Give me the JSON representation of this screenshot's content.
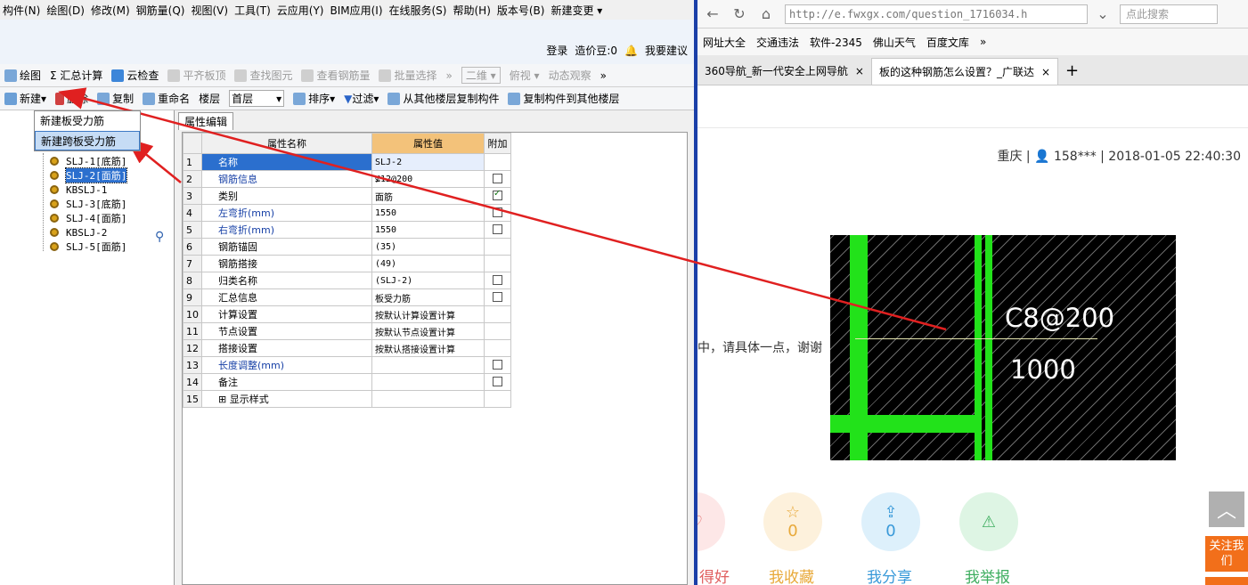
{
  "menu": [
    "构件(N)",
    "绘图(D)",
    "修改(M)",
    "钢筋量(Q)",
    "视图(V)",
    "工具(T)",
    "云应用(Y)",
    "BIM应用(I)",
    "在线服务(S)",
    "帮助(H)",
    "版本号(B)",
    "新建变更 ▾"
  ],
  "login": {
    "login": "登录",
    "beans": "造价豆:0",
    "suggest": "我要建议"
  },
  "toolbar1": [
    "绘图",
    "Σ 汇总计算",
    "云检查",
    "平齐板顶",
    "查找图元",
    "查看钢筋量",
    "批量选择",
    "二维",
    "俯视",
    "动态观察"
  ],
  "toolbar2": {
    "new": "新建",
    "delete": "删除",
    "copy": "复制",
    "rename": "重命名",
    "floor_label": "楼层",
    "floor_value": "首层",
    "sort": "排序",
    "filter": "过滤",
    "copy_from": "从其他楼层复制构件",
    "copy_to": "复制构件到其他楼层"
  },
  "dropdown": [
    "新建板受力筋",
    "新建跨板受力筋"
  ],
  "tree": [
    "SLJ-1[底筋]",
    "SLJ-2[面筋]",
    "KBSLJ-1",
    "SLJ-3[底筋]",
    "SLJ-4[面筋]",
    "KBSLJ-2",
    "SLJ-5[面筋]"
  ],
  "panel_tab": "属性编辑",
  "grid": {
    "headers": [
      "属性名称",
      "属性值",
      "附加"
    ],
    "rows": [
      {
        "n": "1",
        "name": "名称",
        "val": "SLJ-2",
        "cb": ""
      },
      {
        "n": "2",
        "name": "钢筋信息",
        "val": "⊈12@200",
        "cb": "off"
      },
      {
        "n": "3",
        "name": "类别",
        "val": "面筋",
        "cb": "on"
      },
      {
        "n": "4",
        "name": "左弯折(mm)",
        "val": "1550",
        "cb": "off"
      },
      {
        "n": "5",
        "name": "右弯折(mm)",
        "val": "1550",
        "cb": "off"
      },
      {
        "n": "6",
        "name": "钢筋锚固",
        "val": "(35)",
        "cb": ""
      },
      {
        "n": "7",
        "name": "钢筋搭接",
        "val": "(49)",
        "cb": ""
      },
      {
        "n": "8",
        "name": "归类名称",
        "val": "(SLJ-2)",
        "cb": "off"
      },
      {
        "n": "9",
        "name": "汇总信息",
        "val": "板受力筋",
        "cb": "off"
      },
      {
        "n": "10",
        "name": "计算设置",
        "val": "按默认计算设置计算",
        "cb": ""
      },
      {
        "n": "11",
        "name": "节点设置",
        "val": "按默认节点设置计算",
        "cb": ""
      },
      {
        "n": "12",
        "name": "搭接设置",
        "val": "按默认搭接设置计算",
        "cb": ""
      },
      {
        "n": "13",
        "name": "长度调整(mm)",
        "val": "",
        "cb": "off"
      },
      {
        "n": "14",
        "name": "备注",
        "val": "",
        "cb": "off"
      },
      {
        "n": "15",
        "name": "⊞ 显示样式",
        "val": "",
        "cb": ""
      }
    ]
  },
  "browser": {
    "url": "http://e.fwxgx.com/question_1716034.h",
    "search_placeholder": "点此搜索",
    "favorites": [
      "网址大全",
      "交通违法",
      "软件-2345",
      "佛山天气",
      "百度文库"
    ],
    "tabs": [
      "360导航_新一代安全上网导航",
      "板的这种钢筋怎么设置？_广联达"
    ],
    "meta": "重庆 | 👤 158*** | 2018-01-05 22:40:30",
    "question": "中，请具体一点，谢谢",
    "cad_text1": "C8@200",
    "cad_text2": "1000",
    "actions": [
      {
        "count": "",
        "label": "得好"
      },
      {
        "count": "0",
        "label": "我收藏"
      },
      {
        "count": "0",
        "label": "我分享"
      },
      {
        "count": "",
        "label": "我举报"
      }
    ],
    "follow": "关注我们"
  },
  "colors": {
    "arrow": "#e02020",
    "cad_green": "#22e21a",
    "select_blue": "#2b6fce"
  }
}
